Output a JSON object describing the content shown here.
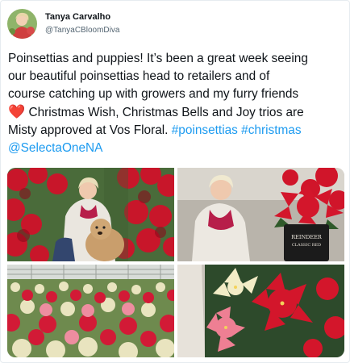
{
  "author": {
    "name": "Tanya Carvalho",
    "handle": "@TanyaCBloomDiva"
  },
  "tweet": {
    "line1": "Poinsettias and puppies! It’s been a great week seeing",
    "line2": "our beautiful poinsettias head to retailers and of",
    "line3": "course catching up with growers and my furry friends",
    "heart_icon": "❤️",
    "line4_text": " Christmas Wish, Christmas Bells and Joy trios are",
    "line5_text": "Misty approved at Vos Floral. ",
    "hashtag1": "#poinsettias",
    "hashtag2": "#christmas",
    "mention": "@SelectaOneNA"
  },
  "media": {
    "pot_label_line1": "REINDEER",
    "pot_label_line2": "CLASSIC RED"
  },
  "colors": {
    "link": "#1d9bf0",
    "text": "#0f1419",
    "secondary": "#536471"
  }
}
